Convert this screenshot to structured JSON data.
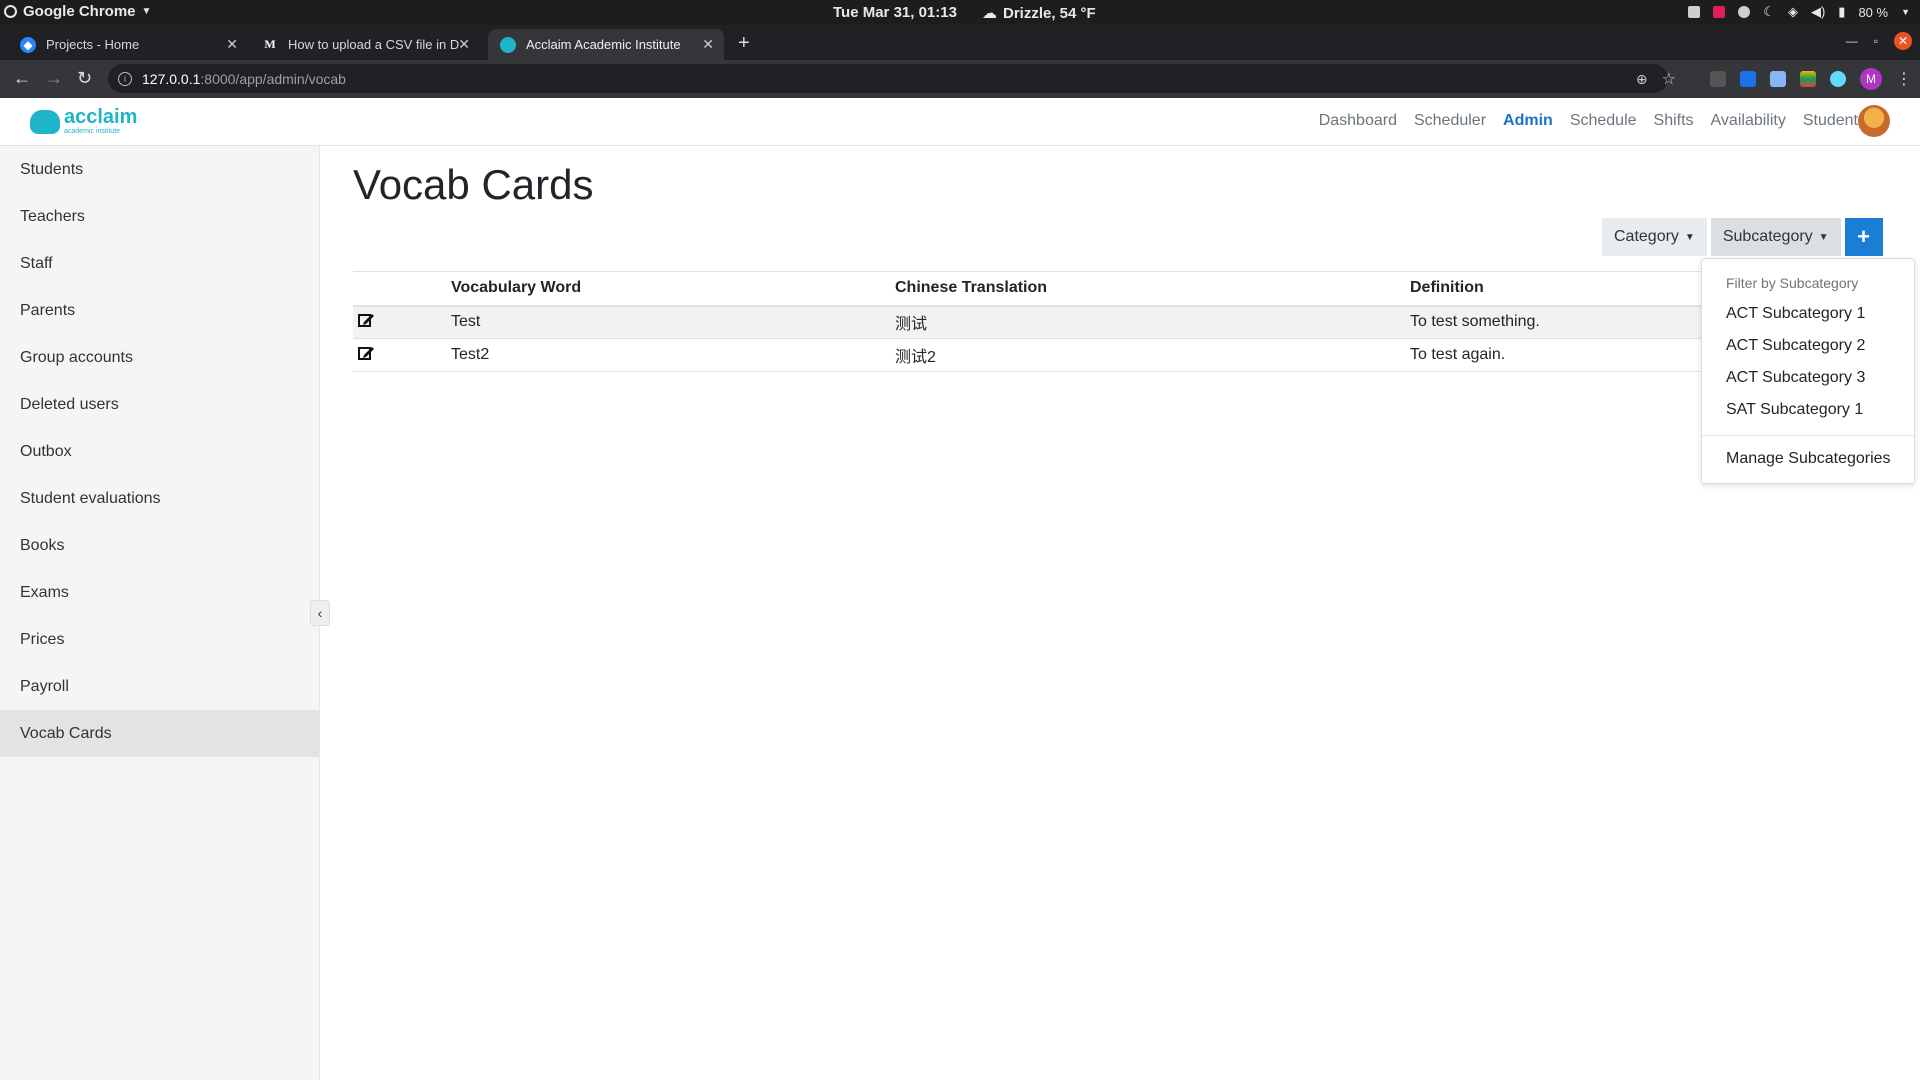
{
  "os_bar": {
    "app_name": "Google Chrome",
    "clock": "Tue Mar 31, 01:13",
    "weather": "Drizzle, 54 °F",
    "battery": "80 %"
  },
  "browser": {
    "tabs": [
      {
        "title": "Projects - Home"
      },
      {
        "title": "How to upload a CSV file in D"
      },
      {
        "title": "Acclaim Academic Institute"
      }
    ],
    "url_host": "127.0.0.1",
    "url_path": ":8000/app/admin/vocab",
    "profile_initial": "M"
  },
  "navbar": {
    "logo_text": "acclaim",
    "logo_sub": "academic institute",
    "links": [
      "Dashboard",
      "Scheduler",
      "Admin",
      "Schedule",
      "Shifts",
      "Availability",
      "Students"
    ],
    "active_link": "Admin"
  },
  "sidebar": {
    "items": [
      "Students",
      "Teachers",
      "Staff",
      "Parents",
      "Group accounts",
      "Deleted users",
      "Outbox",
      "Student evaluations",
      "Books",
      "Exams",
      "Prices",
      "Payroll",
      "Vocab Cards"
    ],
    "active_item": "Vocab Cards",
    "collapse_glyph": "‹"
  },
  "main": {
    "title": "Vocab Cards",
    "filters": {
      "category_label": "Category",
      "subcategory_label": "Subcategory",
      "add_label": "+"
    },
    "table": {
      "headers": [
        "",
        "Vocabulary Word",
        "Chinese Translation",
        "Definition"
      ],
      "rows": [
        {
          "word": "Test",
          "translation": "测试",
          "definition": "To test something."
        },
        {
          "word": "Test2",
          "translation": "测试2",
          "definition": "To test again."
        }
      ]
    },
    "dropdown": {
      "header": "Filter by Subcategory",
      "items": [
        "ACT Subcategory 1",
        "ACT Subcategory 2",
        "ACT Subcategory 3",
        "SAT Subcategory 1"
      ],
      "manage_label": "Manage Subcategories"
    }
  },
  "colors": {
    "accent": "#1a7fd4",
    "brand": "#1fb5c9",
    "nav_active": "#1a73c8"
  }
}
